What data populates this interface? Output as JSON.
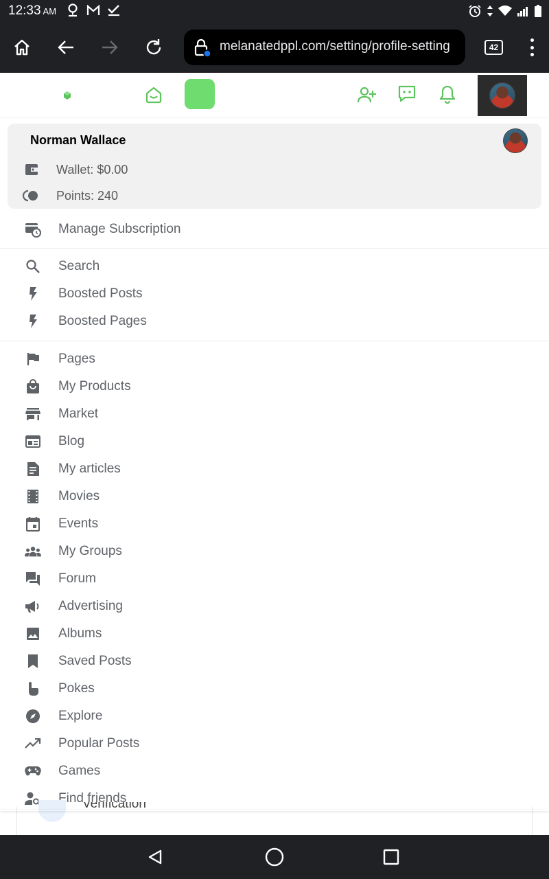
{
  "status_bar": {
    "time": "12:33",
    "ampm": "AM",
    "left_icons": [
      "pin-icon",
      "gmail-icon",
      "check-icon"
    ],
    "right_icons": [
      "alarm-icon",
      "data-arrows-icon",
      "wifi-icon",
      "signal-icon",
      "battery-icon"
    ]
  },
  "browser": {
    "url": "melanatedppl.com/setting/profile-setting",
    "tab_count": "42"
  },
  "user_card": {
    "name": "Norman Wallace",
    "wallet": "Wallet: $0.00",
    "points": "Points: 240"
  },
  "menu": {
    "manage_subscription": "Manage Subscription",
    "group1": [
      {
        "label": "Search",
        "icon": "search-icon"
      },
      {
        "label": "Boosted Posts",
        "icon": "bolt-icon"
      },
      {
        "label": "Boosted Pages",
        "icon": "bolt-icon"
      }
    ],
    "group2": [
      {
        "label": "Pages",
        "icon": "flag-icon"
      },
      {
        "label": "My Products",
        "icon": "shopping-bag-icon"
      },
      {
        "label": "Market",
        "icon": "store-icon"
      },
      {
        "label": "Blog",
        "icon": "blog-icon"
      },
      {
        "label": "My articles",
        "icon": "article-icon"
      },
      {
        "label": "Movies",
        "icon": "film-icon"
      },
      {
        "label": "Events",
        "icon": "calendar-icon"
      },
      {
        "label": "My Groups",
        "icon": "groups-icon"
      },
      {
        "label": "Forum",
        "icon": "forum-icon"
      },
      {
        "label": "Advertising",
        "icon": "megaphone-icon"
      },
      {
        "label": "Albums",
        "icon": "image-icon"
      },
      {
        "label": "Saved Posts",
        "icon": "bookmark-icon"
      },
      {
        "label": "Pokes",
        "icon": "poke-hand-icon"
      },
      {
        "label": "Explore",
        "icon": "compass-icon"
      },
      {
        "label": "Popular Posts",
        "icon": "trending-icon"
      },
      {
        "label": "Games",
        "icon": "gamepad-icon"
      },
      {
        "label": "Find friends",
        "icon": "person-search-icon"
      }
    ]
  },
  "background": {
    "partial_label": "Verification"
  },
  "colors": {
    "accent_green": "#5cc45c",
    "bar_dark": "#202124",
    "menu_text": "#5f6368"
  }
}
